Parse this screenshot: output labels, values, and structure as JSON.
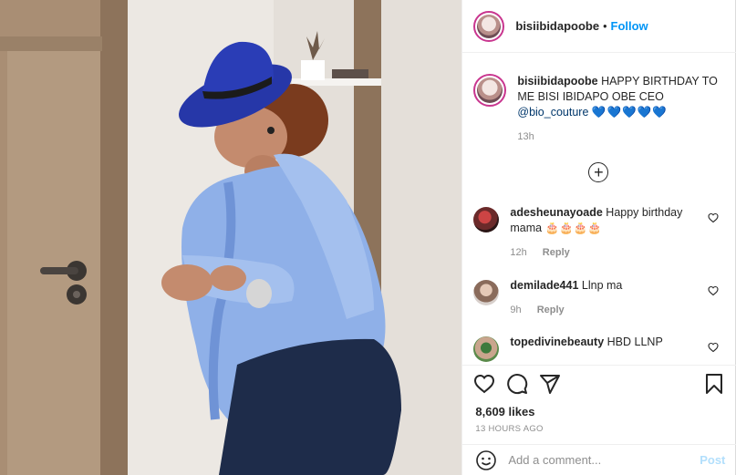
{
  "post": {
    "username": "bisiibidapoobe",
    "follow_label": "Follow",
    "separator": "•"
  },
  "caption": {
    "username": "bisiibidapoobe",
    "text": "HAPPY BIRTHDAY TO ME BISI IBIDAPO OBE CEO",
    "mention": "@bio_couture",
    "hearts": "💙💙💙💙💙",
    "age": "13h"
  },
  "load_more_label": "+",
  "comments": [
    {
      "username": "adesheunayoade",
      "text": "Happy birthday mama",
      "emoji": "🎂🎂🎂🎂",
      "age": "12h",
      "reply_label": "Reply"
    },
    {
      "username": "demilade441",
      "text": "Llnp ma",
      "emoji": "",
      "age": "9h",
      "reply_label": "Reply"
    },
    {
      "username": "topedivinebeauty",
      "text": "HBD LLNP",
      "emoji": "",
      "age": "",
      "reply_label": ""
    }
  ],
  "engagement": {
    "likes": "8,609 likes",
    "timestamp": "13 HOURS AGO"
  },
  "composer": {
    "placeholder": "Add a comment...",
    "post_label": "Post"
  },
  "icons": {
    "like": "heart-icon",
    "comment": "comment-icon",
    "share": "share-icon",
    "save": "bookmark-icon",
    "emoji": "emoji-icon",
    "load_more": "plus-circle-icon"
  },
  "colors": {
    "link_blue": "#0095f6",
    "mention_blue": "#00376b",
    "post_disabled": "#b2dffc",
    "muted": "#8e8e8e",
    "text": "#262626"
  }
}
